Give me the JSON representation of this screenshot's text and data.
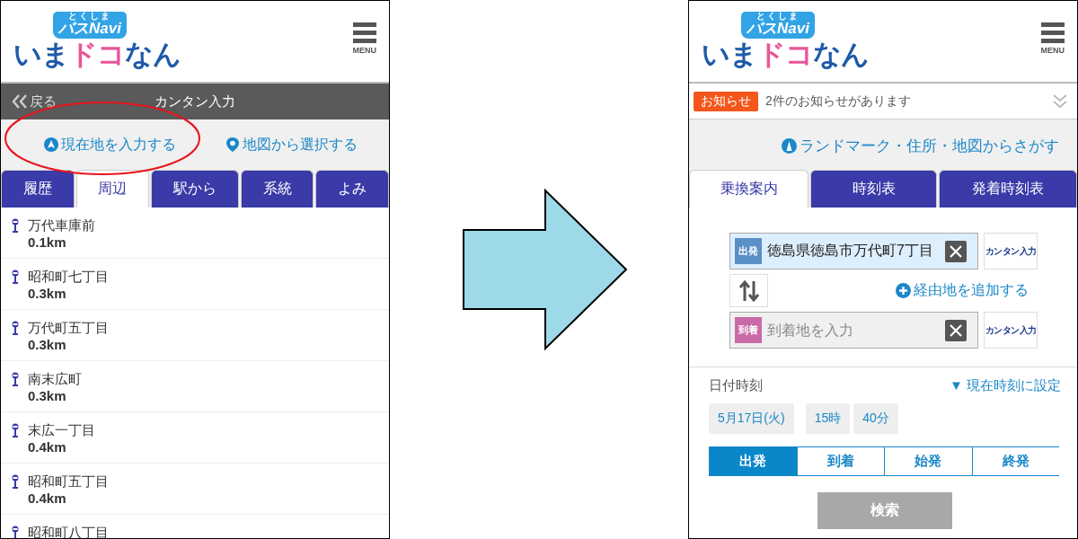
{
  "left_screen": {
    "logo": {
      "ruby": "とくしま",
      "badge": "バスNavi",
      "parts": [
        {
          "text": "いま",
          "kind": "plain"
        },
        {
          "text": "ドコ",
          "kind": "accent"
        },
        {
          "text": "なん",
          "kind": "plain"
        }
      ]
    },
    "menu_label": "MENU",
    "title_bar": {
      "back": "戻る",
      "title": "カンタン入力"
    },
    "actions": [
      {
        "kind": "current",
        "label": "現在地を入力する"
      },
      {
        "kind": "map",
        "label": "地図から選択する"
      }
    ],
    "tabs": [
      {
        "label": "履歴",
        "selected": false
      },
      {
        "label": "周辺",
        "selected": true
      },
      {
        "label": "駅から",
        "selected": false
      },
      {
        "label": "系統",
        "selected": false
      },
      {
        "label": "よみ",
        "selected": false
      }
    ],
    "stops": [
      {
        "name": "万代車庫前",
        "distance": "0.1km"
      },
      {
        "name": "昭和町七丁目",
        "distance": "0.3km"
      },
      {
        "name": "万代町五丁目",
        "distance": "0.3km"
      },
      {
        "name": "南末広町",
        "distance": "0.3km"
      },
      {
        "name": "末広一丁目",
        "distance": "0.4km"
      },
      {
        "name": "昭和町五丁目",
        "distance": "0.4km"
      },
      {
        "name": "昭和町八丁目"
      }
    ]
  },
  "annotation": {
    "kind": "ellipse"
  },
  "transition": {
    "kind": "arrow"
  },
  "right_screen": {
    "logo": {
      "ruby": "とくしま",
      "badge": "バスNavi",
      "parts": [
        {
          "text": "いま",
          "kind": "plain"
        },
        {
          "text": "ドコ",
          "kind": "accent"
        },
        {
          "text": "なん",
          "kind": "plain"
        }
      ]
    },
    "menu_label": "MENU",
    "notice": {
      "badge": "お知らせ",
      "text": "2件のお知らせがあります"
    },
    "search_link": "ランドマーク・住所・地図からさがす",
    "tabs": [
      {
        "label": "乗換案内",
        "selected": true
      },
      {
        "label": "時刻表",
        "selected": false
      },
      {
        "label": "発着時刻表",
        "selected": false
      }
    ],
    "fields": [
      {
        "tag": "出発",
        "color": "#5b8fc7",
        "value": "徳島県徳島市万代町7丁目",
        "button": "カンタン入力"
      },
      {
        "tag": "到着",
        "color": "#c86aa6",
        "placeholder": "到着地を入力",
        "button": "カンタン入力"
      }
    ],
    "add_via": "経由地を追加する",
    "date_label": "日付時刻",
    "now_link": "▼ 現在時刻に設定",
    "date_chips": [
      "5月17日(火)",
      "15時",
      "40分"
    ],
    "modes": [
      {
        "label": "出発",
        "selected": true
      },
      {
        "label": "到着",
        "selected": false
      },
      {
        "label": "始発",
        "selected": false
      },
      {
        "label": "終発",
        "selected": false
      }
    ],
    "search_button": {
      "label": "検索",
      "disabled": true
    }
  }
}
